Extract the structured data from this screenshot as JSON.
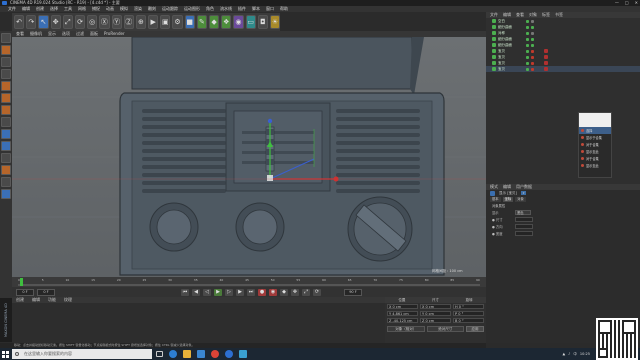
{
  "window": {
    "title": "CINEMA 4D R19.024 Studio (RC - R19) - [4.c4d *] - 主要"
  },
  "menubar": [
    "文件",
    "编辑",
    "创建",
    "选择",
    "工具",
    "网格",
    "捕捉",
    "动画",
    "模拟",
    "渲染",
    "雕刻",
    "运动跟踪",
    "运动图形",
    "角色",
    "流水线",
    "插件",
    "脚本",
    "窗口",
    "帮助"
  ],
  "viewport": {
    "menu": [
      "查看",
      "摄像机",
      "显示",
      "选项",
      "过滤",
      "面板",
      "ProRender"
    ],
    "grid_label": "网格间距 : 100 cm"
  },
  "timeline": {
    "ticks": [
      "0",
      "5",
      "10",
      "15",
      "20",
      "25",
      "30",
      "35",
      "40",
      "45",
      "50",
      "55",
      "60",
      "65",
      "70",
      "75",
      "80",
      "85",
      "90"
    ],
    "frame_start": "0 F",
    "frame_end": "90 F",
    "current_frame": "0 F"
  },
  "materials": {
    "menu": [
      "创建",
      "编辑",
      "功能",
      "纹理"
    ]
  },
  "coordinates": {
    "headers": [
      "位置",
      "尺寸",
      "旋转"
    ],
    "rows": [
      {
        "pos": "X  0 cm",
        "size": "X  0 cm",
        "rot": "H  0 °"
      },
      {
        "pos": "Y  4.861 cm",
        "size": "Y  0 cm",
        "rot": "P  0 °"
      },
      {
        "pos": "Z  -40.125 cm",
        "size": "Z  0 cm",
        "rot": "B  0 °"
      }
    ],
    "mode": "对象（相对）",
    "size_mode": "绝对尺寸",
    "apply": "应用"
  },
  "status": "移动：点击并拖动鼠标移动元素。按住 SHIFT 键量化移动；节点编辑模式时按住 SHIFT 键增加选择对象；按住 CTRL 键减少选择对象。",
  "object_manager": {
    "menu": [
      "文件",
      "编辑",
      "查看",
      "对象",
      "标签",
      "书签"
    ],
    "objects": [
      "空白",
      "细分曲面",
      "对称",
      "细分曲面",
      "细分曲面",
      "宝贝",
      "宝贝",
      "宝贝",
      "宝贝"
    ]
  },
  "context_menu": [
    "选择",
    "显示于合集",
    "对于合集",
    "显示至此",
    "对于合集",
    "显示至此"
  ],
  "attributes": {
    "tabs": [
      "模式",
      "编辑",
      "用户数据"
    ],
    "object_name": "显示 [宝贝]",
    "sub_tabs": [
      "基本",
      "坐标",
      "对象"
    ],
    "section": "对象属性",
    "props": [
      {
        "label": "显示",
        "value": "黑色"
      },
      {
        "label": "● 尺寸",
        "value": ""
      },
      {
        "label": "● 方向",
        "value": ""
      },
      {
        "label": "● 宽度",
        "value": ""
      }
    ]
  },
  "taskbar": {
    "search_placeholder": "在这里输入你要搜索的内容",
    "time": "10:25",
    "lang": "中"
  },
  "brand": "MAXON CINEMA 4D",
  "colors": {
    "accent": "#3d6fa8",
    "viewport_bg": "#64686b",
    "model": "#4f5a64",
    "green_axis": "#3fbf3f"
  }
}
